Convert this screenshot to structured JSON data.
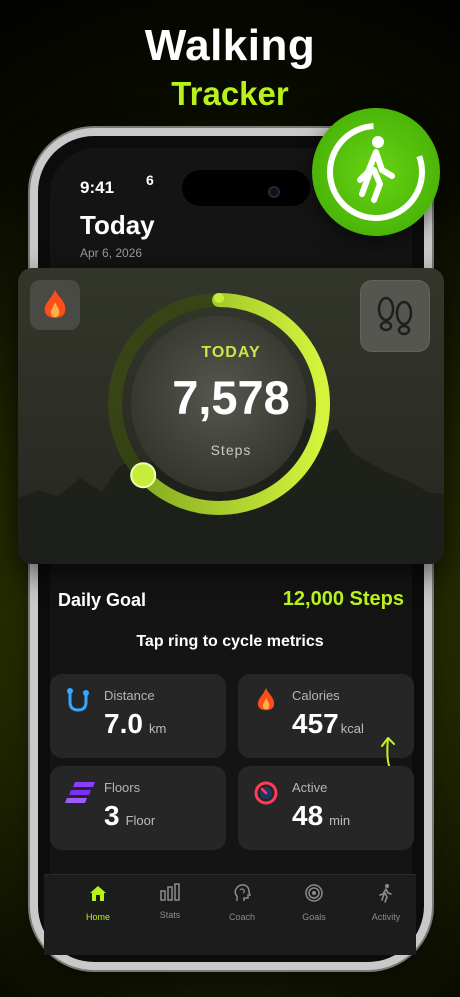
{
  "promo": {
    "title": "Walking",
    "subtitle": "Tracker"
  },
  "status": {
    "time": "9:41",
    "signal": "6"
  },
  "header": {
    "title": "Today",
    "date": "Apr 6, 2026"
  },
  "ring": {
    "label": "TODAY",
    "value": "7,578",
    "unit": "Steps",
    "progress": 0.63
  },
  "goal": {
    "label": "Daily Goal",
    "value": "12,000 Steps"
  },
  "hint": "Tap ring to cycle metrics",
  "metrics": {
    "distance": {
      "label": "Distance",
      "value": "7.0",
      "unit": "km",
      "icon": "route-icon"
    },
    "calories": {
      "label": "Calories",
      "value": "457",
      "unit": "kcal",
      "icon": "flame-icon"
    },
    "floors": {
      "label": "Floors",
      "value": "3",
      "unit": "Floor",
      "icon": "stairs-icon"
    },
    "active": {
      "label": "Active",
      "value": "48",
      "unit": "min",
      "icon": "timer-icon"
    }
  },
  "tabs": [
    {
      "label": "Home",
      "icon": "home-icon",
      "active": true
    },
    {
      "label": "Stats",
      "icon": "bar-chart-icon",
      "active": false
    },
    {
      "label": "Coach",
      "icon": "brain-icon",
      "active": false
    },
    {
      "label": "Goals",
      "icon": "target-icon",
      "active": false
    },
    {
      "label": "Activity",
      "icon": "walker-icon",
      "active": false
    }
  ],
  "colors": {
    "accent": "#b8f21c",
    "background": "#141414",
    "tile": "#262626"
  }
}
